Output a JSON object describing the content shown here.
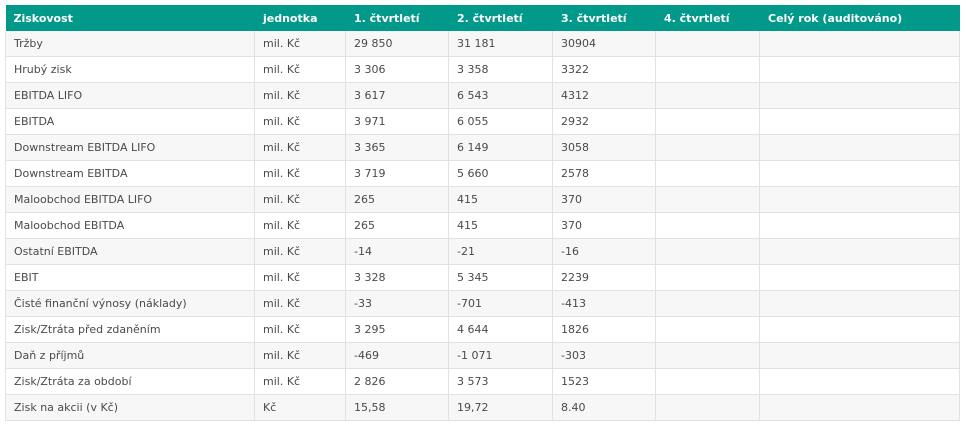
{
  "table": {
    "headers": [
      "Ziskovost",
      "jednotka",
      "1. čtvrtletí",
      "2. čtvrtletí",
      "3. čtvrtletí",
      "4. čtvrtletí",
      "Celý rok (auditováno)"
    ],
    "rows": [
      [
        "Tržby",
        "mil. Kč",
        "29 850",
        "31 181",
        "30904",
        "",
        ""
      ],
      [
        "Hrubý zisk",
        "mil. Kč",
        "3 306",
        "3 358",
        "3322",
        "",
        ""
      ],
      [
        "EBITDA LIFO",
        "mil. Kč",
        "3 617",
        "6 543",
        "4312",
        "",
        ""
      ],
      [
        "EBITDA",
        "mil. Kč",
        "3 971",
        "6 055",
        "2932",
        "",
        ""
      ],
      [
        "Downstream EBITDA LIFO",
        "mil. Kč",
        "3 365",
        "6 149",
        "3058",
        "",
        ""
      ],
      [
        "Downstream EBITDA",
        "mil. Kč",
        "3 719",
        "5 660",
        "2578",
        "",
        ""
      ],
      [
        "Maloobchod EBITDA LIFO",
        "mil. Kč",
        "265",
        "415",
        "370",
        "",
        ""
      ],
      [
        "Maloobchod EBITDA",
        "mil. Kč",
        "265",
        "415",
        "370",
        "",
        ""
      ],
      [
        "Ostatní EBITDA",
        "mil. Kč",
        "-14",
        "-21",
        "-16",
        "",
        ""
      ],
      [
        "EBIT",
        "mil. Kč",
        "3 328",
        "5 345",
        "2239",
        "",
        ""
      ],
      [
        "Čisté finanční výnosy (náklady)",
        "mil. Kč",
        "-33",
        "-701",
        "-413",
        "",
        ""
      ],
      [
        "Zisk/Ztráta před zdaněním",
        "mil. Kč",
        "3 295",
        "4 644",
        "1826",
        "",
        ""
      ],
      [
        "Daň z příjmů",
        "mil. Kč",
        "-469",
        "-1 071",
        "-303",
        "",
        ""
      ],
      [
        "Zisk/Ztráta za období",
        "mil. Kč",
        "2 826",
        "3 573",
        "1523",
        "",
        ""
      ],
      [
        "Zisk na akcii (v Kč)",
        "Kč",
        "15,58",
        "19,72",
        "8.40",
        "",
        ""
      ]
    ]
  },
  "colors": {
    "header_bg": "#00998a",
    "header_text": "#ffffff",
    "row_alt_bg": "#f7f7f7",
    "border": "#e2e2e2"
  }
}
